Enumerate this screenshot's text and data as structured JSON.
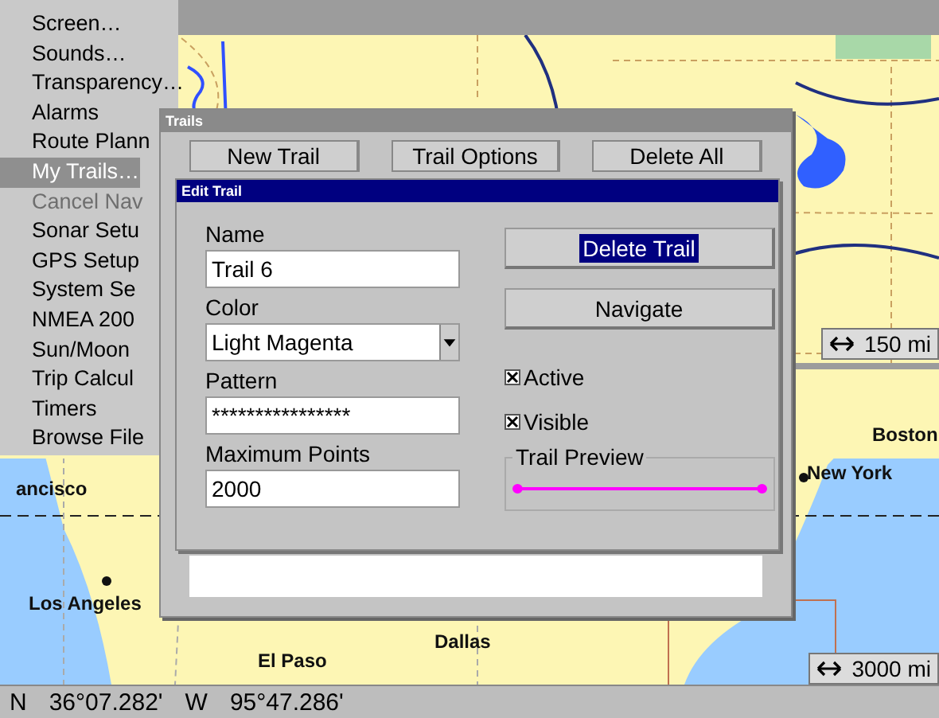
{
  "menu": {
    "items": [
      {
        "label": "Screen…",
        "selected": false,
        "disabled": false
      },
      {
        "label": "Sounds…",
        "selected": false,
        "disabled": false
      },
      {
        "label": "Transparency…",
        "selected": false,
        "disabled": false
      },
      {
        "label": "Alarms",
        "selected": false,
        "disabled": false
      },
      {
        "label": "Route Plann",
        "selected": false,
        "disabled": false
      },
      {
        "label": "My Trails…",
        "selected": true,
        "disabled": false
      },
      {
        "label": "Cancel Nav",
        "selected": false,
        "disabled": true
      },
      {
        "label": "Sonar Setu",
        "selected": false,
        "disabled": false
      },
      {
        "label": "GPS Setup",
        "selected": false,
        "disabled": false
      },
      {
        "label": "System Se",
        "selected": false,
        "disabled": false
      },
      {
        "label": "NMEA 200",
        "selected": false,
        "disabled": false
      },
      {
        "label": "Sun/Moon",
        "selected": false,
        "disabled": false
      },
      {
        "label": "Trip Calcul",
        "selected": false,
        "disabled": false
      },
      {
        "label": "Timers",
        "selected": false,
        "disabled": false
      },
      {
        "label": "Browse File",
        "selected": false,
        "disabled": false
      }
    ]
  },
  "upper_map": {
    "scale": "150 mi"
  },
  "lower_map": {
    "cities": [
      "Boston",
      "New York",
      "ancisco",
      "Los Angeles",
      "El Paso",
      "Dallas"
    ],
    "scale": "3000 mi"
  },
  "trails_window": {
    "title": "Trails",
    "buttons": [
      "New Trail",
      "Trail Options",
      "Delete All"
    ]
  },
  "edit_trail": {
    "title": "Edit Trail",
    "fields": [
      {
        "label": "Name",
        "kind": "text",
        "value": "Trail 6"
      },
      {
        "label": "Color",
        "kind": "select",
        "value": "Light Magenta"
      },
      {
        "label": "Pattern",
        "kind": "text",
        "value": "****************"
      },
      {
        "label": "Maximum Points",
        "kind": "text",
        "value": "2000"
      }
    ],
    "buttons": [
      {
        "label": "Delete Trail",
        "selected": true
      },
      {
        "label": "Navigate",
        "selected": false
      }
    ],
    "checkboxes": [
      {
        "label": "Active",
        "checked": true
      },
      {
        "label": "Visible",
        "checked": true
      }
    ],
    "preview": {
      "label": "Trail Preview",
      "color": "#ff00ff"
    }
  },
  "status_bar": {
    "lat_hemisphere": "N",
    "latitude": "36°07.282'",
    "lon_hemisphere": "W",
    "longitude": "95°47.286'"
  }
}
